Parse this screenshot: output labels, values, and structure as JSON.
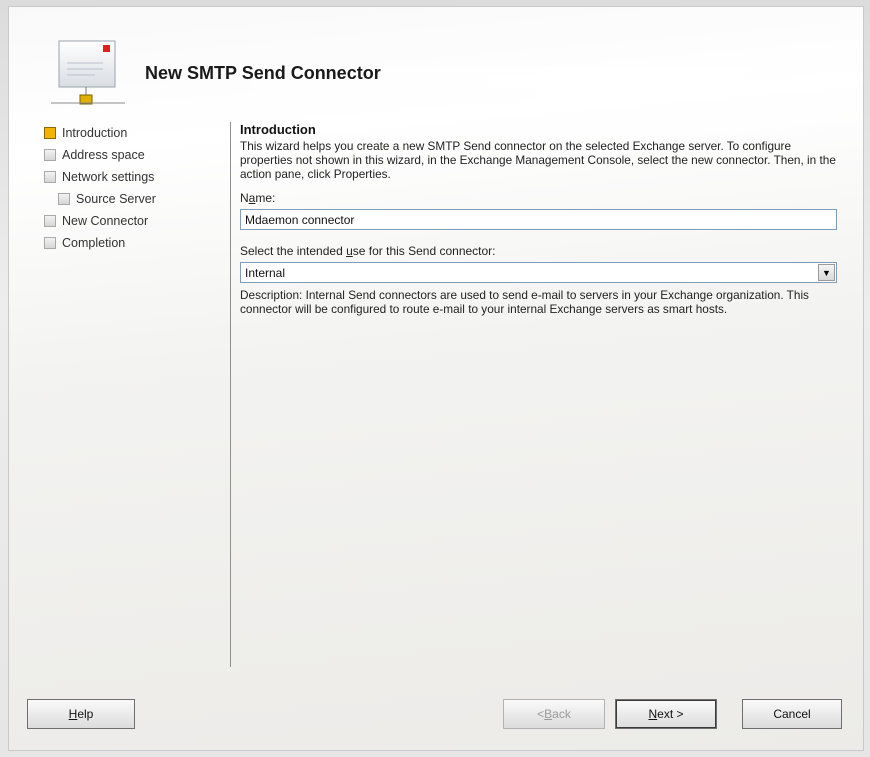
{
  "wizard": {
    "title": "New SMTP Send Connector"
  },
  "steps": [
    {
      "label": "Introduction",
      "active": true
    },
    {
      "label": "Address space",
      "active": false
    },
    {
      "label": "Network settings",
      "active": false
    },
    {
      "label": "Source Server",
      "active": false,
      "sub": true
    },
    {
      "label": "New Connector",
      "active": false
    },
    {
      "label": "Completion",
      "active": false
    }
  ],
  "content": {
    "section_title": "Introduction",
    "intro_text": "This wizard helps you create a new SMTP Send connector on the selected Exchange server. To configure properties not shown in this wizard, in the Exchange Management Console, select the new connector. Then, in the action pane, click Properties.",
    "name_label_pre": "N",
    "name_label_u": "a",
    "name_label_post": "me:",
    "name_value": "Mdaemon connector",
    "use_label_pre": "Select the intended ",
    "use_label_u": "u",
    "use_label_post": "se for this Send connector:",
    "use_value": "Internal",
    "description": "Description: Internal Send connectors are used to send e-mail to servers in your Exchange organization. This connector will be configured to route e-mail to your internal Exchange servers as smart hosts."
  },
  "buttons": {
    "help_u": "H",
    "help_rest": "elp",
    "back_pre": "< ",
    "back_u": "B",
    "back_rest": "ack",
    "next_u": "N",
    "next_rest": "ext >",
    "cancel": "Cancel"
  },
  "icons": {
    "header": "send-connector-icon",
    "dropdown": "chevron-down-icon"
  },
  "colors": {
    "active_step": "#f1b400",
    "field_border": "#7f9db9"
  }
}
